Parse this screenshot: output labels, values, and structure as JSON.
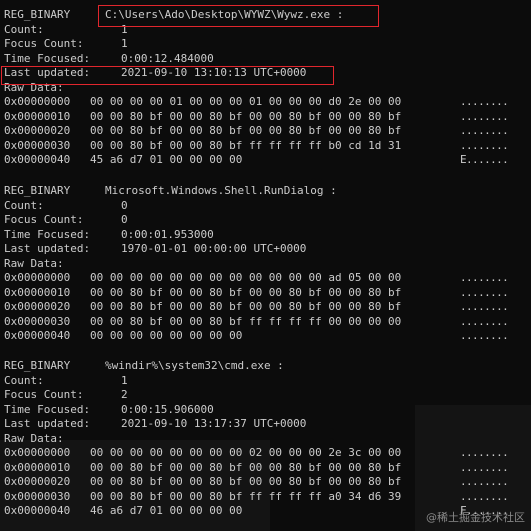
{
  "entries": [
    {
      "type": "REG_BINARY",
      "name": "C:\\Users\\Ado\\Desktop\\WYWZ\\Wywz.exe :",
      "count_label": "Count:",
      "count": "1",
      "focus_count_label": "Focus Count:",
      "focus_count": "1",
      "time_focused_label": "Time Focused:",
      "time_focused": "0:00:12.484000",
      "last_updated_label": "Last updated:",
      "last_updated": "2021-09-10 13:10:13 UTC+0000",
      "raw_label": "Raw Data:",
      "rows": [
        {
          "off": "0x00000000",
          "hex": "00 00 00 00 01 00 00 00 01 00 00 00 d0 2e 00 00",
          "ascii": "........"
        },
        {
          "off": "0x00000010",
          "hex": "00 00 80 bf 00 00 80 bf 00 00 80 bf 00 00 80 bf",
          "ascii": "........"
        },
        {
          "off": "0x00000020",
          "hex": "00 00 80 bf 00 00 80 bf 00 00 80 bf 00 00 80 bf",
          "ascii": "........"
        },
        {
          "off": "0x00000030",
          "hex": "00 00 80 bf 00 00 80 bf ff ff ff ff b0 cd 1d 31",
          "ascii": "........"
        },
        {
          "off": "0x00000040",
          "hex": "45 a6 d7 01 00 00 00 00",
          "ascii": "E......."
        }
      ]
    },
    {
      "type": "REG_BINARY",
      "name": "Microsoft.Windows.Shell.RunDialog :",
      "count_label": "Count:",
      "count": "0",
      "focus_count_label": "Focus Count:",
      "focus_count": "0",
      "time_focused_label": "Time Focused:",
      "time_focused": "0:00:01.953000",
      "last_updated_label": "Last updated:",
      "last_updated": "1970-01-01 00:00:00 UTC+0000",
      "raw_label": "Raw Data:",
      "rows": [
        {
          "off": "0x00000000",
          "hex": "00 00 00 00 00 00 00 00 00 00 00 00 ad 05 00 00",
          "ascii": "........"
        },
        {
          "off": "0x00000010",
          "hex": "00 00 80 bf 00 00 80 bf 00 00 80 bf 00 00 80 bf",
          "ascii": "........"
        },
        {
          "off": "0x00000020",
          "hex": "00 00 80 bf 00 00 80 bf 00 00 80 bf 00 00 80 bf",
          "ascii": "........"
        },
        {
          "off": "0x00000030",
          "hex": "00 00 80 bf 00 00 80 bf ff ff ff ff 00 00 00 00",
          "ascii": "........"
        },
        {
          "off": "0x00000040",
          "hex": "00 00 00 00 00 00 00 00",
          "ascii": "........"
        }
      ]
    },
    {
      "type": "REG_BINARY",
      "name": "%windir%\\system32\\cmd.exe :",
      "count_label": "Count:",
      "count": "1",
      "focus_count_label": "Focus Count:",
      "focus_count": "2",
      "time_focused_label": "Time Focused:",
      "time_focused": "0:00:15.906000",
      "last_updated_label": "Last updated:",
      "last_updated": "2021-09-10 13:17:37 UTC+0000",
      "raw_label": "Raw Data:",
      "rows": [
        {
          "off": "0x00000000",
          "hex": "00 00 00 00 00 00 00 00 02 00 00 00 2e 3c 00 00",
          "ascii": "........"
        },
        {
          "off": "0x00000010",
          "hex": "00 00 80 bf 00 00 80 bf 00 00 80 bf 00 00 80 bf",
          "ascii": "........"
        },
        {
          "off": "0x00000020",
          "hex": "00 00 80 bf 00 00 80 bf 00 00 80 bf 00 00 80 bf",
          "ascii": "........"
        },
        {
          "off": "0x00000030",
          "hex": "00 00 80 bf 00 00 80 bf ff ff ff ff a0 34 d6 39",
          "ascii": "........"
        },
        {
          "off": "0x00000040",
          "hex": "46 a6 d7 01 00 00 00 00",
          "ascii": "F......."
        }
      ]
    }
  ],
  "watermark": "@稀土掘金技术社区",
  "highlight_color": "#e1262d"
}
